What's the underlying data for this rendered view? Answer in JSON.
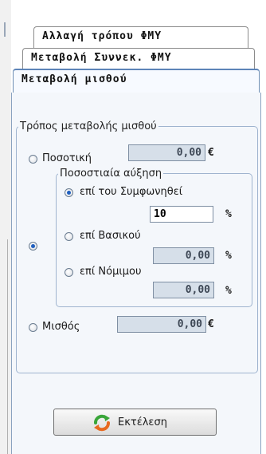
{
  "tabs": [
    {
      "label": "Αλλαγή τρόπου ΦΜΥ"
    },
    {
      "label": "Μεταβολή Συννεκ. ΦΜΥ"
    },
    {
      "label": "Μεταβολή μισθού"
    }
  ],
  "salary_change": {
    "group_title": "Τρόπος μεταβολής μισθού",
    "amount_option": {
      "label": "Ποσοτική",
      "value": "0,00",
      "currency": "€"
    },
    "percent_option": {
      "group_title": "Ποσοστιαία αύξηση",
      "on_agreed": {
        "label": "επί του Συμφωνηθεί",
        "value": "10",
        "unit": "%"
      },
      "on_basic": {
        "label": "επί Βασικού",
        "value": "0,00",
        "unit": "%"
      },
      "on_legal": {
        "label": "επί Νόμιμου",
        "value": "0,00",
        "unit": "%"
      }
    },
    "salary_option": {
      "label": "Μισθός",
      "value": "0,00",
      "currency": "€"
    }
  },
  "execute_button": {
    "label": "Εκτέλεση",
    "icon": "refresh-icon"
  },
  "colors": {
    "accent": "#1f5fbf",
    "panel": "#f4f7fb",
    "disabled_field": "#d6dfe9"
  }
}
